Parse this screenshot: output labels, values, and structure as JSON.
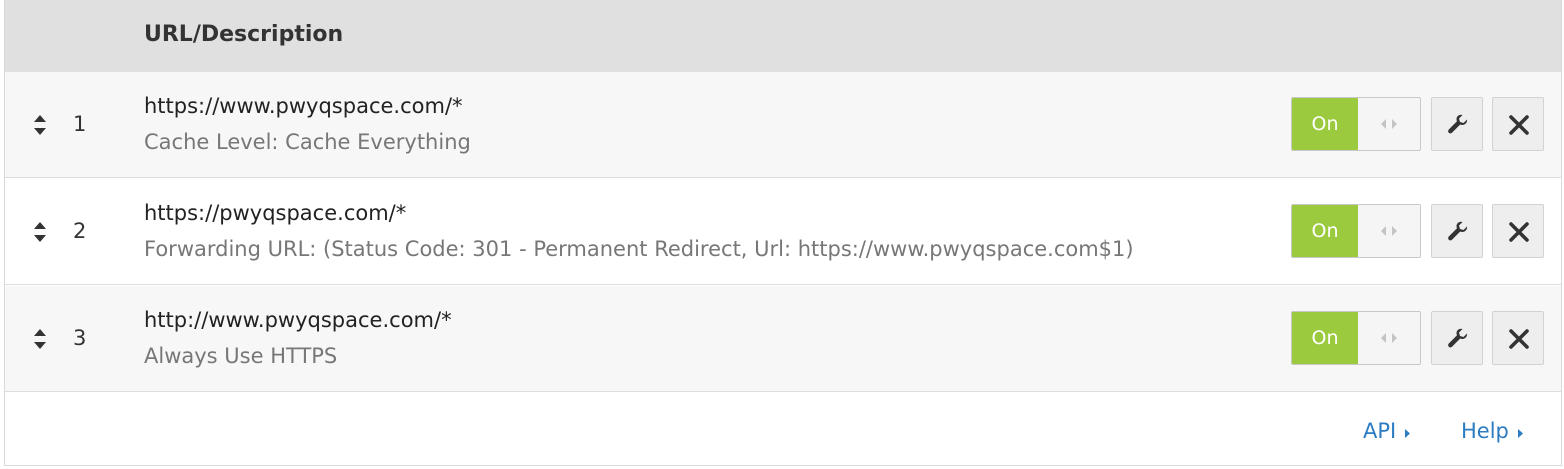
{
  "table": {
    "header": "URL/Description",
    "rows": [
      {
        "index": "1",
        "url": "https://www.pwyqspace.com/*",
        "description": "Cache Level: Cache Everything",
        "toggle_label": "On"
      },
      {
        "index": "2",
        "url": "https://pwyqspace.com/*",
        "description": "Forwarding URL: (Status Code: 301 - Permanent Redirect, Url: https://www.pwyqspace.com$1)",
        "toggle_label": "On"
      },
      {
        "index": "3",
        "url": "http://www.pwyqspace.com/*",
        "description": "Always Use HTTPS",
        "toggle_label": "On"
      }
    ]
  },
  "footer": {
    "api_label": "API",
    "help_label": "Help"
  },
  "icons": {
    "sort": "sort-icon",
    "toggle_handle": "drag-handle-icon",
    "edit": "wrench-icon",
    "delete": "close-icon",
    "caret": "caret-right-icon"
  },
  "colors": {
    "toggle_on": "#9bca3e",
    "link": "#2c7cc1",
    "header_bg": "#e0e0e0"
  }
}
